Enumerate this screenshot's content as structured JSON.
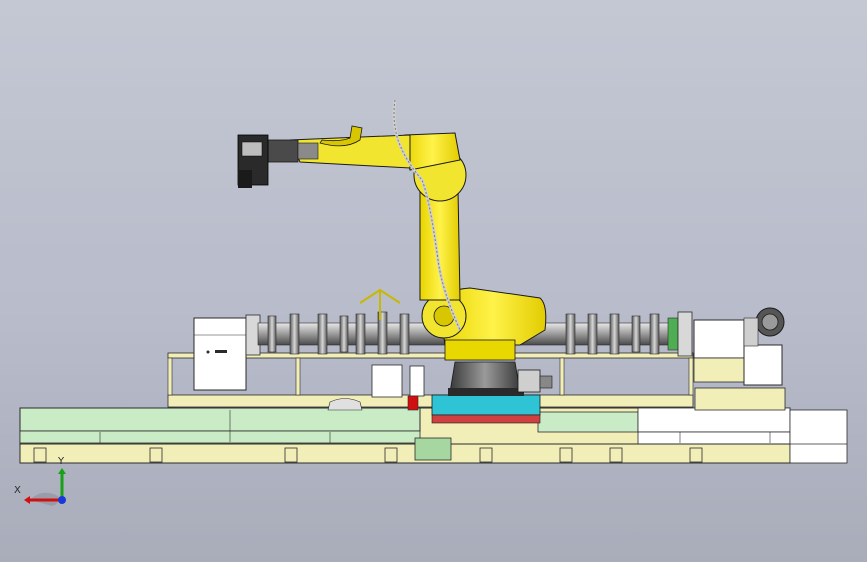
{
  "viewport": {
    "background_top": "#c4c8d3",
    "background_bottom": "#a9adba"
  },
  "scene": {
    "robot_color": "#f2e530",
    "base_color": "#f2eeb8",
    "green_panel_color": "#c9ecc6",
    "cyan_plate_color": "#2ec4d6",
    "line_color": "#2b2b2b"
  },
  "triad": {
    "x_label": "X",
    "y_label": "Y",
    "x_color": "#d01010",
    "y_color": "#18a018",
    "z_color": "#1a38d8"
  }
}
